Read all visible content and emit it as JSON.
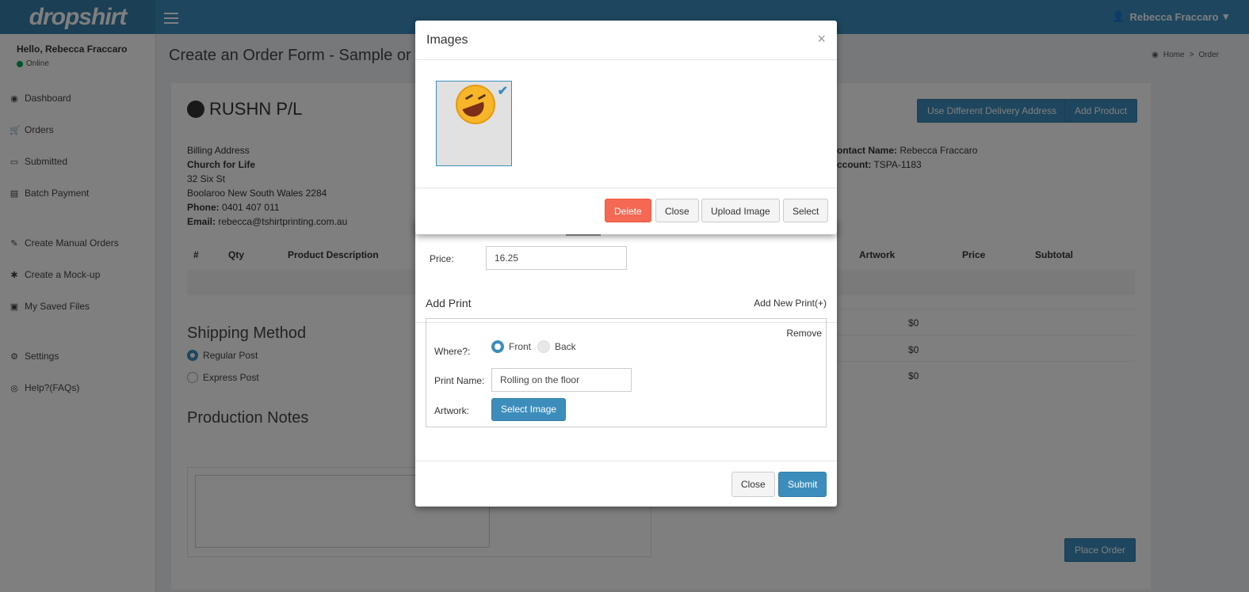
{
  "app": {
    "logo": "dropshirt",
    "user": "Rebecca Fraccaro"
  },
  "sidebar": {
    "hello": "Hello, Rebecca Fraccaro",
    "status": "Online",
    "items": [
      {
        "label": "Dashboard",
        "icon": "dashboard-icon"
      },
      {
        "label": "Orders",
        "icon": "cart-icon"
      },
      {
        "label": "Submitted",
        "icon": "folder-icon"
      },
      {
        "label": "Batch Payment",
        "icon": "money-icon"
      },
      {
        "label": "Create Manual Orders",
        "icon": "edit-icon"
      },
      {
        "label": "Create a Mock-up",
        "icon": "asterisk-icon"
      },
      {
        "label": "My Saved Files",
        "icon": "save-icon"
      },
      {
        "label": "Settings",
        "icon": "gear-icon"
      },
      {
        "label": "Help?(FAQs)",
        "icon": "lifebuoy-icon"
      }
    ]
  },
  "page": {
    "title": "Create an Order Form - Sample or M",
    "breadcrumb": [
      "Home",
      "Order"
    ],
    "company": "RUSHN P/L",
    "buttons": {
      "different_address": "Use Different Delivery Address",
      "add_product": "Add Product",
      "place_order": "Place Order"
    },
    "billing": {
      "heading": "Billing Address",
      "org": "Church for Life",
      "street": "32 Six St",
      "city": "Boolaroo New South Wales 2284",
      "phone_label": "Phone:",
      "phone": "0401 407 011",
      "email_label": "Email:",
      "email": "rebecca@tshirtprinting.com.au"
    },
    "contact": {
      "name_label": "ontact Name:",
      "name": "Rebecca Fraccaro",
      "account_label": "ccount:",
      "account": "TSPA-1183"
    },
    "table_headers": [
      "#",
      "Qty",
      "Product Description",
      "Artwork",
      "Price",
      "Subtotal"
    ],
    "totals": [
      "$0",
      "$0",
      "$0"
    ],
    "shipping": {
      "heading": "Shipping Method",
      "regular": "Regular Post",
      "express": "Express Post"
    },
    "notes_heading": "Production Notes"
  },
  "product_modal": {
    "price_label": "Price:",
    "price_value": "16.25",
    "add_print": "Add Print",
    "add_new_print": "Add New Print(+)",
    "remove": "Remove",
    "where_label": "Where?:",
    "front": "Front",
    "back": "Back",
    "print_name_label": "Print Name:",
    "print_name_value": "Rolling on the floor",
    "artwork_label": "Artwork:",
    "select_image": "Select Image",
    "close": "Close",
    "submit": "Submit"
  },
  "images_modal": {
    "title": "Images",
    "close_x": "×",
    "delete": "Delete",
    "close": "Close",
    "upload": "Upload Image",
    "select": "Select",
    "thumbnail_icon": "rofl-emoji-icon"
  },
  "colors": {
    "primary": "#3c8dbc",
    "danger": "#f56954",
    "header": "#3c8dbc"
  }
}
